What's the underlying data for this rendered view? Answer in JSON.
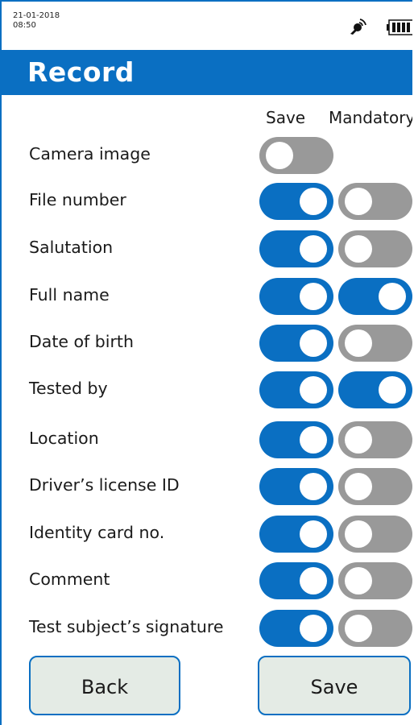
{
  "status": {
    "date": "21-01-2018",
    "time": "08:50",
    "icons": [
      "signal-icon",
      "battery-icon"
    ]
  },
  "header": {
    "title": "Record"
  },
  "columns": {
    "save": "Save",
    "mandatory": "Mandatory"
  },
  "rows": [
    {
      "label": "Camera image",
      "save": false,
      "mandatory": null
    },
    {
      "label": "File number",
      "save": true,
      "mandatory": false
    },
    {
      "label": "Salutation",
      "save": true,
      "mandatory": false
    },
    {
      "label": "Full name",
      "save": true,
      "mandatory": true
    },
    {
      "label": "Date of birth",
      "save": true,
      "mandatory": false
    },
    {
      "label": "Tested by",
      "save": true,
      "mandatory": true
    },
    {
      "label": "Location",
      "save": true,
      "mandatory": false
    },
    {
      "label": "Driver’s license ID",
      "save": true,
      "mandatory": false
    },
    {
      "label": "Identity card no.",
      "save": true,
      "mandatory": false
    },
    {
      "label": "Comment",
      "save": true,
      "mandatory": false
    },
    {
      "label": "Test subject’s signature",
      "save": true,
      "mandatory": false
    }
  ],
  "buttons": {
    "back": "Back",
    "save": "Save"
  },
  "colors": {
    "accent": "#0a6fc2",
    "toggle_off": "#999999",
    "button_bg": "#e4ebe5"
  }
}
